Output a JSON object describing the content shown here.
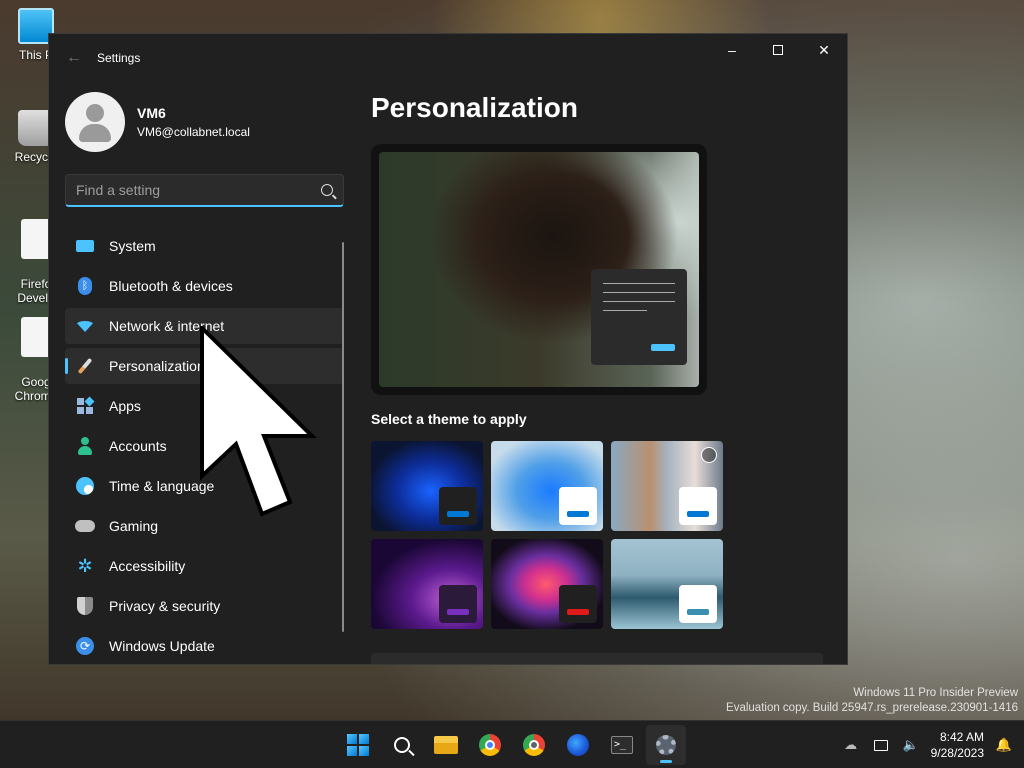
{
  "desktop": {
    "icons": [
      {
        "label": "This P",
        "glyph": "pc-icon"
      },
      {
        "label": "Recycle",
        "glyph": "recycle-bin-icon"
      },
      {
        "label": "Firefo\nDevelo",
        "glyph": "firefox-dev-shortcut-icon"
      },
      {
        "label": "Goog\nChrome",
        "glyph": "chrome-shortcut-icon"
      }
    ],
    "watermark_line1": "Windows 11 Pro Insider Preview",
    "watermark_line2": "Evaluation copy. Build 25947.rs_prerelease.230901-1416"
  },
  "window": {
    "title": "Settings",
    "controls": {
      "minimize": "minimize-icon",
      "maximize": "maximize-icon",
      "close": "close-icon"
    }
  },
  "profile": {
    "name": "VM6",
    "email": "VM6@collabnet.local"
  },
  "search": {
    "placeholder": "Find a setting",
    "value": ""
  },
  "nav": {
    "items": [
      {
        "label": "System",
        "icon": "system-icon",
        "color": "#4cc2ff"
      },
      {
        "label": "Bluetooth & devices",
        "icon": "bluetooth-icon",
        "color": "#3b8eea"
      },
      {
        "label": "Network & internet",
        "icon": "wifi-icon",
        "color": "#4cc2ff"
      },
      {
        "label": "Personalization",
        "icon": "brush-icon",
        "color": "#e8a05b",
        "active": true
      },
      {
        "label": "Apps",
        "icon": "apps-icon",
        "color": "#9ab8e0"
      },
      {
        "label": "Accounts",
        "icon": "accounts-icon",
        "color": "#2fc08f"
      },
      {
        "label": "Time & language",
        "icon": "globe-clock-icon",
        "color": "#4cc2ff"
      },
      {
        "label": "Gaming",
        "icon": "gamepad-icon",
        "color": "#c0c0c0"
      },
      {
        "label": "Accessibility",
        "icon": "accessibility-icon",
        "color": "#4cc2ff"
      },
      {
        "label": "Privacy & security",
        "icon": "shield-icon",
        "color": "#a0a0a0"
      },
      {
        "label": "Windows Update",
        "icon": "update-icon",
        "color": "#3b8eea"
      }
    ]
  },
  "main": {
    "title": "Personalization",
    "theme_section_label": "Select a theme to apply",
    "themes": [
      {
        "name": "windows-dark",
        "chip_color": "#202020",
        "bar_color": "#0078d4"
      },
      {
        "name": "windows-light",
        "chip_color": "#ffffff",
        "bar_color": "#0078d4"
      },
      {
        "name": "windows-spotlight",
        "chip_color": "#ffffff",
        "bar_color": "#0078d4"
      },
      {
        "name": "glow",
        "chip_color": "#2b1a3a",
        "bar_color": "#7b2fbe"
      },
      {
        "name": "captured-motion",
        "chip_color": "#202020",
        "bar_color": "#e0191a"
      },
      {
        "name": "flow",
        "chip_color": "#ffffff",
        "bar_color": "#3a8fb0"
      }
    ]
  },
  "taskbar": {
    "apps": [
      {
        "name": "start-button-icon",
        "active": false
      },
      {
        "name": "search-icon",
        "active": false
      },
      {
        "name": "file-explorer-icon",
        "active": false
      },
      {
        "name": "chrome-icon",
        "active": false
      },
      {
        "name": "chrome-dev-icon",
        "active": false
      },
      {
        "name": "firefox-icon",
        "active": false
      },
      {
        "name": "terminal-icon",
        "active": false
      },
      {
        "name": "settings-icon",
        "active": true
      }
    ],
    "time": "8:42 AM",
    "date": "9/28/2023"
  }
}
